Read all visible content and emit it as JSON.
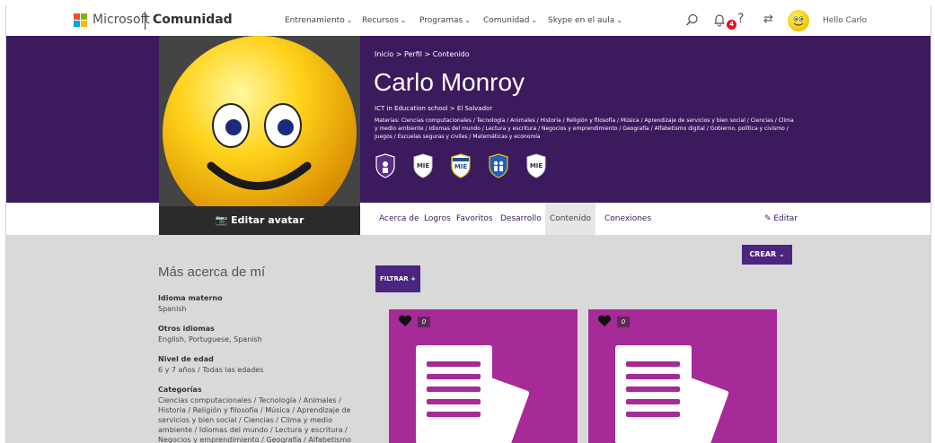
{
  "nav": {
    "brand": "Microsoft",
    "section": "Comunidad",
    "menus": [
      "Entrenamiento",
      "Recursos",
      "Programas",
      "Comunidad",
      "Skype en el aula"
    ],
    "notification_count": "4",
    "help": "?",
    "greeting": "Hello Carlo"
  },
  "profile": {
    "breadcrumb": "Inicio  >  Perfil  >  Contenido",
    "name": "Carlo Monroy",
    "school": "ICT in Education school  >  El Salvador",
    "materias": "Materias: Ciencias computacionales / Tecnología / Animales / Historia / Religión y filosofía / Música / Aprendizaje de servicios y bien social / Ciencias / Clima y medio ambiente / Idiomas del mundo / Lectura y escritura / Negocios y emprendimiento / Geografía / Alfabetismo digital / Gobierno, política y civismo / Juegos / Escuelas seguras y civiles / Matemáticas y economía",
    "edit_avatar": "Editar avatar",
    "badge_labels": [
      "MIE",
      "MIE",
      "MIE"
    ]
  },
  "tabs": [
    "Acerca de",
    "Logros",
    "Favoritos",
    "Desarrollo",
    "Contenido",
    "Conexiones"
  ],
  "active_tab": "Contenido",
  "edit_label": "Editar",
  "about": {
    "title": "Más acerca de mí",
    "idioma_label": "Idioma materno",
    "idioma_value": "Spanish",
    "otros_label": "Otros idiomas",
    "otros_value": "English, Portuguese, Spanish",
    "nivel_label": "Nivel de edad",
    "nivel_value": "6 y 7 años / Todas las edades",
    "categorias_label": "Categorías",
    "categorias_value": "Ciencias computacionales / Tecnología / Animales / Historia / Religión y filosofía / Música / Aprendizaje de servicios y bien social / Ciencias / Clima y medio ambiente / Idiomas del mundo / Lectura y escritura / Negocios y emprendimiento / Geografía / Alfabetismo digital / ..."
  },
  "buttons": {
    "crear": "CREAR",
    "filtrar": "FILTRAR +"
  },
  "cards": [
    {
      "likes": "0"
    },
    {
      "likes": "0"
    }
  ],
  "colors": {
    "header": "#3b1a5e",
    "accent": "#4b2580",
    "card": "#a62a97"
  }
}
